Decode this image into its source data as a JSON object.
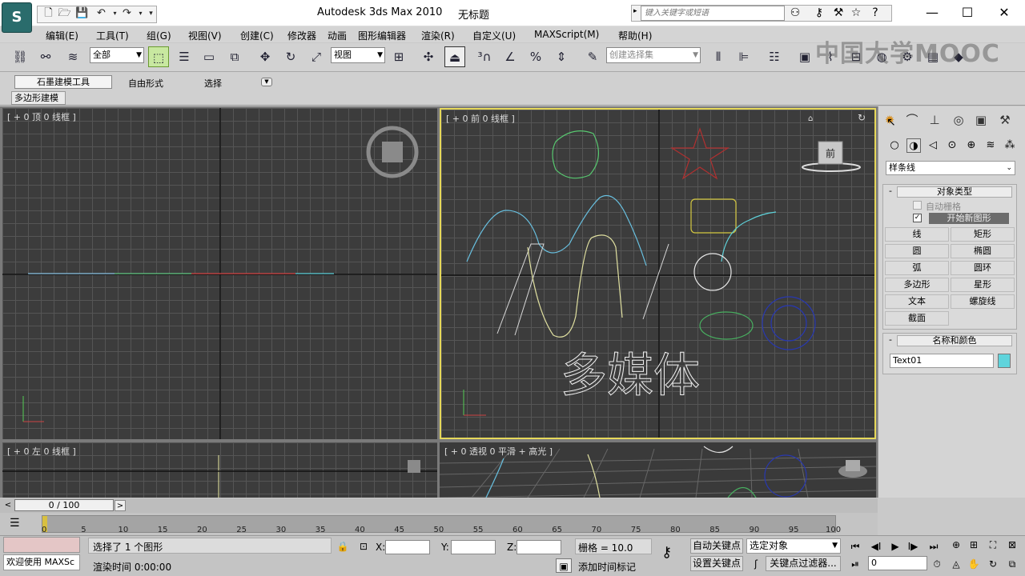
{
  "app": {
    "logo_label": "S",
    "title": "Autodesk 3ds Max  2010",
    "document": "无标题"
  },
  "infocenter": {
    "search_placeholder": "键入关键字或短语",
    "icons": [
      "binoculars-icon",
      "key-icon",
      "tools-icon",
      "star-icon",
      "help-icon"
    ]
  },
  "window_buttons": [
    "—",
    "☐",
    "✕"
  ],
  "menu": [
    "编辑(E)",
    "工具(T)",
    "组(G)",
    "视图(V)",
    "创建(C)",
    "修改器",
    "动画",
    "图形编辑器",
    "渲染(R)",
    "自定义(U)",
    "MAXScript(M)",
    "帮助(H)"
  ],
  "toolbar": {
    "selection_filter": "全部",
    "ref_coord": "视图",
    "named_selection_placeholder": "创建选择集"
  },
  "watermark": "中国大学MOOC",
  "ribbon": {
    "tabs": [
      "石墨建模工具",
      "自由形式",
      "选择"
    ],
    "panel": "多边形建模"
  },
  "viewports": {
    "top": {
      "label": "[ + 0 顶 0 线框 ]"
    },
    "front": {
      "label": "[ + 0 前 0 线框 ]",
      "viewcube": "前",
      "text_object": "多媒体"
    },
    "left": {
      "label": "[ + 0 左 0 线框 ]"
    },
    "persp": {
      "label": "[ + 0 透视 0 平滑 + 高光 ]"
    }
  },
  "command_panel": {
    "category": "样条线",
    "object_type_title": "对象类型",
    "autogrid_label": "自动栅格",
    "start_new_shape": "开始新图形",
    "buttons": [
      "线",
      "矩形",
      "圆",
      "椭圆",
      "弧",
      "圆环",
      "多边形",
      "星形",
      "文本",
      "螺旋线",
      "截面"
    ],
    "name_color_title": "名称和颜色",
    "object_name": "Text01",
    "object_color": "#5fd4dc"
  },
  "timeline": {
    "position": "0 / 100",
    "prev": "<",
    "next": ">",
    "ticks": [
      "0",
      "5",
      "10",
      "15",
      "20",
      "25",
      "30",
      "35",
      "40",
      "45",
      "50",
      "55",
      "60",
      "65",
      "70",
      "75",
      "80",
      "85",
      "90",
      "95",
      "100"
    ]
  },
  "status": {
    "maxscript": "欢迎使用 MAXSc",
    "selection": "选择了 1 个图形",
    "render_time": "渲染时间  0:00:00",
    "x_label": "X:",
    "y_label": "Y:",
    "z_label": "Z:",
    "grid": "栅格 = 10.0",
    "add_time_tag": "添加时间标记",
    "auto_key": "自动关键点",
    "set_key": "设置关键点",
    "key_mode": "选定对象",
    "key_filters": "关键点过滤器...",
    "frame": "0"
  }
}
